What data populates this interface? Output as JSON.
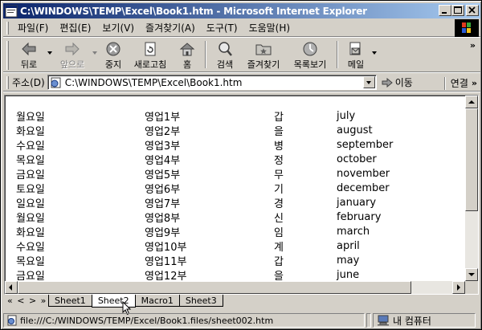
{
  "window": {
    "title": "C:\\WINDOWS\\TEMP\\Excel\\Book1.htm - Microsoft Internet Explorer"
  },
  "menu": {
    "items": [
      "파일(F)",
      "편집(E)",
      "보기(V)",
      "즐겨찾기(A)",
      "도구(T)",
      "도움말(H)"
    ]
  },
  "toolbar": {
    "back": "뒤로",
    "forward": "앞으로",
    "stop": "중지",
    "refresh": "새로고침",
    "home": "홈",
    "search": "검색",
    "favorites": "즐겨찾기",
    "history": "목록보기",
    "mail": "메일",
    "more": "»"
  },
  "address": {
    "label": "주소(D)",
    "url": "C:\\WINDOWS\\TEMP\\Excel\\Book1.htm",
    "go": "이동",
    "links": "연결",
    "more": "»"
  },
  "table": {
    "rows": [
      [
        "월요일",
        "영업1부",
        "갑",
        "july"
      ],
      [
        "화요일",
        "영업2부",
        "을",
        "august"
      ],
      [
        "수요일",
        "영업3부",
        "병",
        "september"
      ],
      [
        "목요일",
        "영업4부",
        "정",
        "october"
      ],
      [
        "금요일",
        "영업5부",
        "무",
        "november"
      ],
      [
        "토요일",
        "영업6부",
        "기",
        "december"
      ],
      [
        "일요일",
        "영업7부",
        "경",
        "january"
      ],
      [
        "월요일",
        "영업8부",
        "신",
        "february"
      ],
      [
        "화요일",
        "영업9부",
        "임",
        "march"
      ],
      [
        "수요일",
        "영업10부",
        "계",
        "april"
      ],
      [
        "목요일",
        "영업11부",
        "갑",
        "may"
      ],
      [
        "금요일",
        "영업12부",
        "을",
        "june"
      ]
    ]
  },
  "sheets": {
    "nav": "« < > »",
    "tabs": [
      "Sheet1",
      "Sheet2",
      "Macro1",
      "Sheet3"
    ],
    "active": "Sheet2"
  },
  "status": {
    "text": "file:///C:/WINDOWS/TEMP/Excel/Book1.files/sheet002.htm",
    "zone": "내 컴퓨터"
  }
}
